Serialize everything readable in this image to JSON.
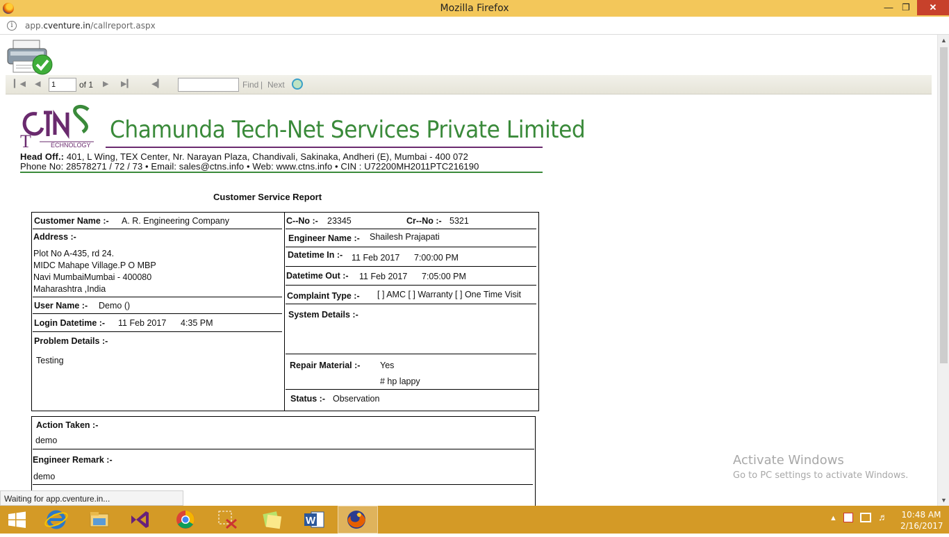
{
  "browser": {
    "title": "Mozilla Firefox",
    "url_host": "app.cventure.in",
    "url_path": "/callreport.aspx",
    "url_prefix": "app.",
    "url_domain": "cventure.in",
    "status": "Waiting for app.cventure.in..."
  },
  "toolbar": {
    "page_value": "1",
    "of_label": "of 1",
    "find_label": "Find",
    "separator": "|",
    "next_label": "Next"
  },
  "header": {
    "logo_text": "ECHNOLOGY",
    "company_name": "Chamunda Tech-Net Services Private Limited",
    "head_office_label": "Head Off.:",
    "head_office": " 401, L Wing, TEX Center, Nr. Narayan Plaza, Chandivali, Sakinaka, Andheri (E), Mumbai - 400 072",
    "contact": "Phone No: 28578271 / 72 / 73 • Email: sales@ctns.info • Web: www.ctns.info • CIN : U72200MH2011PTC216190"
  },
  "report": {
    "title": "Customer Service Report",
    "customer_name_label": "Customer Name :-",
    "customer_name": "A. R. Engineering Company",
    "address_label": "Address :-",
    "address_lines": [
      "Plot No A-435, rd 24.",
      "MIDC Mahape Village.P O MBP",
      "Navi MumbaiMumbai - 400080",
      "Maharashtra ,India"
    ],
    "user_name_label": "User Name :-",
    "user_name": "Demo ()",
    "login_label": "Login Datetime :-",
    "login_date": "11 Feb 2017",
    "login_time": "4:35 PM",
    "problem_label": "Problem Details :-",
    "problem": "Testing",
    "cno_label": "C--No :-",
    "cno": "23345",
    "crno_label": "Cr--No :-",
    "crno": "5321",
    "engineer_label": "Engineer Name :-",
    "engineer": "Shailesh Prajapati",
    "datetime_in_label": "Datetime In :-",
    "datetime_in_date": "11 Feb 2017",
    "datetime_in_time": "7:00:00 PM",
    "datetime_out_label": "Datetime Out :-",
    "datetime_out_date": "11 Feb 2017",
    "datetime_out_time": "7:05:00 PM",
    "complaint_label": "Complaint Type :-",
    "complaint": "[ ] AMC [ ] Warranty [ ] One Time Visit",
    "system_label": "System Details :-",
    "repair_label": "Repair Material :-",
    "repair": "Yes",
    "repair_item": "# hp lappy",
    "status_label": "Status :-",
    "status": "Observation",
    "action_label": "Action Taken :-",
    "action": "demo",
    "remark_label": "Engineer Remark :-",
    "remark": "demo"
  },
  "watermark": {
    "line1": "Activate Windows",
    "line2": "Go to PC settings to activate Windows."
  },
  "taskbar": {
    "time": "10:48 AM",
    "date": "2/16/2017"
  },
  "colors": {
    "titlebar": "#f3c75a",
    "taskbar": "#d49a26",
    "company_green": "#3a8a3a",
    "logo_purple": "#6a2a6e"
  }
}
